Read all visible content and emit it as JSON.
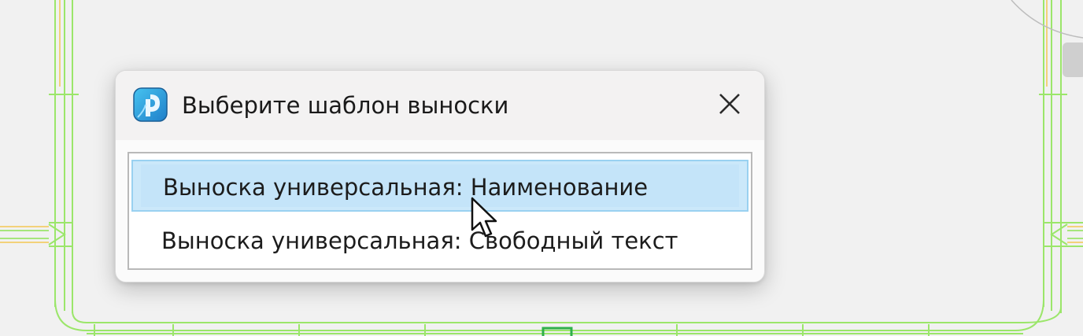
{
  "dialog": {
    "title": "Выберите шаблон выноски",
    "app_icon": "renga-app-icon",
    "close_icon": "close-icon"
  },
  "templates": {
    "items": [
      {
        "label": "Выноска универсальная: Наименование",
        "selected": true
      },
      {
        "label": "Выноска универсальная: Свободный текст",
        "selected": false
      }
    ]
  },
  "colors": {
    "selection_fill": "#cbe8fa",
    "selection_border": "#99d1f1",
    "cad_lines": "#8fe35a",
    "cad_hatch": "#f5d27a"
  }
}
